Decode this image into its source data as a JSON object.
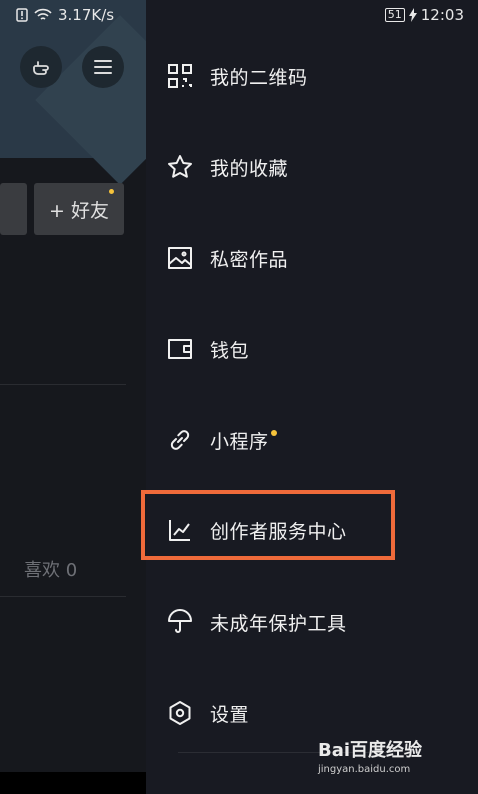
{
  "status": {
    "net_speed": "3.17K/s",
    "battery": "51",
    "time": "12:03"
  },
  "background": {
    "add_friend": "+ 好友",
    "likes": "喜欢 0"
  },
  "menu": {
    "items": [
      {
        "label": "我的二维码",
        "icon": "qr-code-icon"
      },
      {
        "label": "我的收藏",
        "icon": "star-icon"
      },
      {
        "label": "私密作品",
        "icon": "image-icon"
      },
      {
        "label": "钱包",
        "icon": "wallet-icon"
      },
      {
        "label": "小程序",
        "icon": "link-icon",
        "badge": true
      },
      {
        "label": "创作者服务中心",
        "icon": "chart-icon",
        "highlighted": true
      },
      {
        "label": "未成年保护工具",
        "icon": "umbrella-icon"
      },
      {
        "label": "设置",
        "icon": "settings-icon"
      }
    ]
  },
  "watermark": {
    "brand": "Bai百度经验",
    "url": "jingyan.baidu.com"
  },
  "colors": {
    "highlight": "#ef6a3a",
    "badge": "#f5c33b",
    "drawer_bg": "#181a22"
  }
}
